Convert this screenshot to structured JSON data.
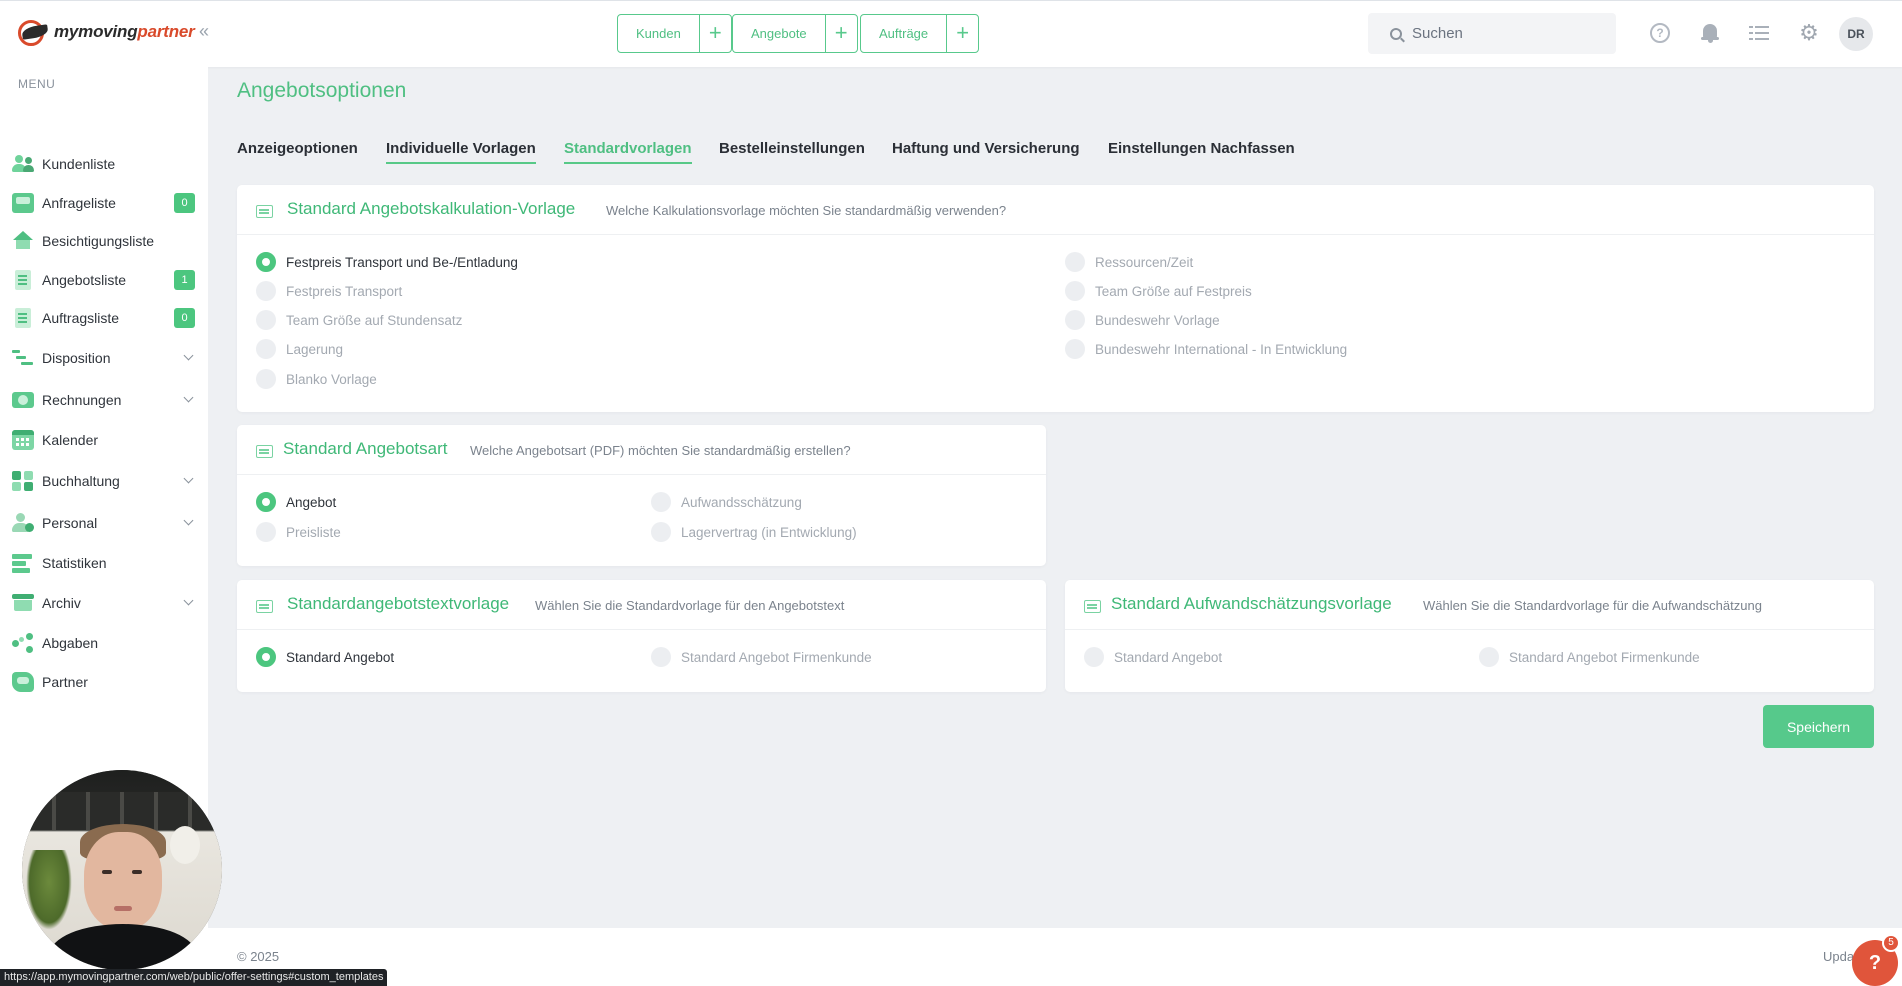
{
  "app": {
    "logo_text_dark": "mymoving",
    "logo_text_brand": "partner",
    "brand_color": "#d94a2b",
    "accent_color": "#4cc67f"
  },
  "header": {
    "quick_actions": [
      {
        "label": "Kunden",
        "plus": "+"
      },
      {
        "label": "Angebote",
        "plus": "+"
      },
      {
        "label": "Aufträge",
        "plus": "+"
      }
    ],
    "search": {
      "placeholder": "Suchen",
      "value": ""
    },
    "help_glyph": "?",
    "avatar_initials": "DR",
    "icons": [
      "help-icon",
      "bell-icon",
      "tasks-icon",
      "gear-icon"
    ]
  },
  "sidebar": {
    "menu_title": "MENU",
    "items": [
      {
        "label": "Kundenliste",
        "icon": "customers-icon"
      },
      {
        "label": "Anfrageliste",
        "icon": "inbox-icon",
        "badge": "0"
      },
      {
        "label": "Besichtigungsliste",
        "icon": "house-icon"
      },
      {
        "label": "Angebotsliste",
        "icon": "offer-doc-icon",
        "badge": "1"
      },
      {
        "label": "Auftragsliste",
        "icon": "order-doc-icon",
        "badge": "0"
      },
      {
        "label": "Disposition",
        "icon": "gantt-icon",
        "expandable": true
      },
      {
        "label": "Rechnungen",
        "icon": "money-icon",
        "expandable": true
      },
      {
        "label": "Kalender",
        "icon": "calendar-icon"
      },
      {
        "label": "Buchhaltung",
        "icon": "grid-icon",
        "expandable": true
      },
      {
        "label": "Personal",
        "icon": "person-icon",
        "expandable": true
      },
      {
        "label": "Statistiken",
        "icon": "stats-icon"
      },
      {
        "label": "Archiv",
        "icon": "archive-icon",
        "expandable": true
      },
      {
        "label": "Abgaben",
        "icon": "share-icon"
      },
      {
        "label": "Partner",
        "icon": "handshake-icon"
      }
    ]
  },
  "main": {
    "title": "Angebotsoptionen",
    "tabs": [
      {
        "label": "Anzeigeoptionen"
      },
      {
        "label": "Individuelle Vorlagen",
        "state": "hover"
      },
      {
        "label": "Standardvorlagen",
        "state": "active"
      },
      {
        "label": "Bestelleinstellungen"
      },
      {
        "label": "Haftung und Versicherung"
      },
      {
        "label": "Einstellungen Nachfassen"
      }
    ],
    "calc_card": {
      "title": "Standard Angebotskalkulation-Vorlage",
      "subtitle": "Welche Kalkulationsvorlage möchten Sie standardmäßig verwenden?",
      "options": [
        {
          "label": "Festpreis Transport und Be-/Entladung",
          "selected": true
        },
        {
          "label": "Festpreis Transport"
        },
        {
          "label": "Team Größe auf Stundensatz"
        },
        {
          "label": "Lagerung"
        },
        {
          "label": "Blanko Vorlage"
        },
        {
          "label": "Ressourcen/Zeit"
        },
        {
          "label": "Team Größe auf Festpreis"
        },
        {
          "label": "Bundeswehr Vorlage"
        },
        {
          "label": "Bundeswehr International - In Entwicklung"
        }
      ]
    },
    "type_card": {
      "title": "Standard Angebotsart",
      "subtitle": "Welche Angebotsart (PDF) möchten Sie standardmäßig erstellen?",
      "options": [
        {
          "label": "Angebot",
          "selected": true
        },
        {
          "label": "Preisliste"
        },
        {
          "label": "Aufwandsschätzung"
        },
        {
          "label": "Lagervertrag (in Entwicklung)"
        }
      ]
    },
    "text_card": {
      "title": "Standardangebotstextvorlage",
      "subtitle": "Wählen Sie die Standardvorlage für den Angebotstext",
      "options": [
        {
          "label": "Standard Angebot",
          "selected": true
        },
        {
          "label": "Standard Angebot Firmenkunde"
        }
      ]
    },
    "estimate_card": {
      "title": "Standard Aufwandschätzungsvorlage",
      "subtitle": "Wählen Sie die Standardvorlage für die Aufwandschätzung",
      "options": [
        {
          "label": "Standard Angebot"
        },
        {
          "label": "Standard Angebot Firmenkunde"
        }
      ]
    },
    "save_label": "Speichern"
  },
  "footer": {
    "copyright": "© 2025",
    "right_text": "Upda",
    "help_glyph": "?",
    "help_count": "5"
  },
  "status_bar": {
    "url": "https://app.mymovingpartner.com/web/public/offer-settings#custom_templates"
  }
}
